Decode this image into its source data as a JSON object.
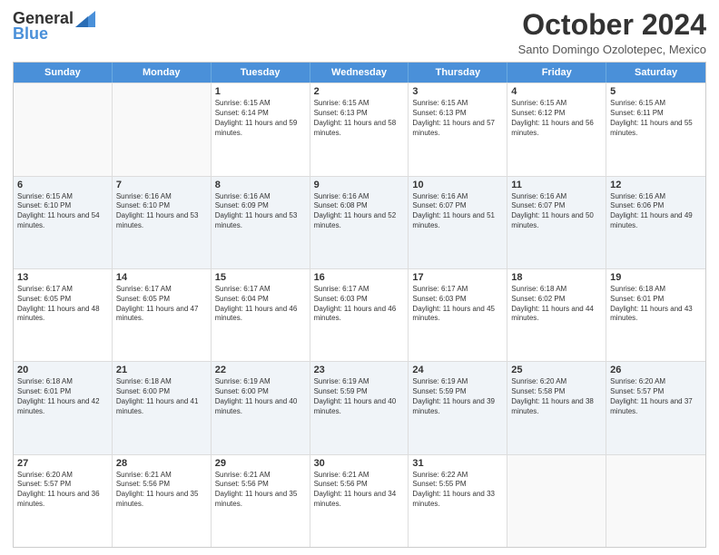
{
  "logo": {
    "general": "General",
    "blue": "Blue"
  },
  "title": "October 2024",
  "location": "Santo Domingo Ozolotepec, Mexico",
  "days": [
    "Sunday",
    "Monday",
    "Tuesday",
    "Wednesday",
    "Thursday",
    "Friday",
    "Saturday"
  ],
  "weeks": [
    [
      {
        "day": "",
        "info": "",
        "empty": true
      },
      {
        "day": "",
        "info": "",
        "empty": true
      },
      {
        "day": "1",
        "info": "Sunrise: 6:15 AM\nSunset: 6:14 PM\nDaylight: 11 hours and 59 minutes."
      },
      {
        "day": "2",
        "info": "Sunrise: 6:15 AM\nSunset: 6:13 PM\nDaylight: 11 hours and 58 minutes."
      },
      {
        "day": "3",
        "info": "Sunrise: 6:15 AM\nSunset: 6:13 PM\nDaylight: 11 hours and 57 minutes."
      },
      {
        "day": "4",
        "info": "Sunrise: 6:15 AM\nSunset: 6:12 PM\nDaylight: 11 hours and 56 minutes."
      },
      {
        "day": "5",
        "info": "Sunrise: 6:15 AM\nSunset: 6:11 PM\nDaylight: 11 hours and 55 minutes."
      }
    ],
    [
      {
        "day": "6",
        "info": "Sunrise: 6:15 AM\nSunset: 6:10 PM\nDaylight: 11 hours and 54 minutes.",
        "shaded": true
      },
      {
        "day": "7",
        "info": "Sunrise: 6:16 AM\nSunset: 6:10 PM\nDaylight: 11 hours and 53 minutes.",
        "shaded": true
      },
      {
        "day": "8",
        "info": "Sunrise: 6:16 AM\nSunset: 6:09 PM\nDaylight: 11 hours and 53 minutes.",
        "shaded": true
      },
      {
        "day": "9",
        "info": "Sunrise: 6:16 AM\nSunset: 6:08 PM\nDaylight: 11 hours and 52 minutes.",
        "shaded": true
      },
      {
        "day": "10",
        "info": "Sunrise: 6:16 AM\nSunset: 6:07 PM\nDaylight: 11 hours and 51 minutes.",
        "shaded": true
      },
      {
        "day": "11",
        "info": "Sunrise: 6:16 AM\nSunset: 6:07 PM\nDaylight: 11 hours and 50 minutes.",
        "shaded": true
      },
      {
        "day": "12",
        "info": "Sunrise: 6:16 AM\nSunset: 6:06 PM\nDaylight: 11 hours and 49 minutes.",
        "shaded": true
      }
    ],
    [
      {
        "day": "13",
        "info": "Sunrise: 6:17 AM\nSunset: 6:05 PM\nDaylight: 11 hours and 48 minutes."
      },
      {
        "day": "14",
        "info": "Sunrise: 6:17 AM\nSunset: 6:05 PM\nDaylight: 11 hours and 47 minutes."
      },
      {
        "day": "15",
        "info": "Sunrise: 6:17 AM\nSunset: 6:04 PM\nDaylight: 11 hours and 46 minutes."
      },
      {
        "day": "16",
        "info": "Sunrise: 6:17 AM\nSunset: 6:03 PM\nDaylight: 11 hours and 46 minutes."
      },
      {
        "day": "17",
        "info": "Sunrise: 6:17 AM\nSunset: 6:03 PM\nDaylight: 11 hours and 45 minutes."
      },
      {
        "day": "18",
        "info": "Sunrise: 6:18 AM\nSunset: 6:02 PM\nDaylight: 11 hours and 44 minutes."
      },
      {
        "day": "19",
        "info": "Sunrise: 6:18 AM\nSunset: 6:01 PM\nDaylight: 11 hours and 43 minutes."
      }
    ],
    [
      {
        "day": "20",
        "info": "Sunrise: 6:18 AM\nSunset: 6:01 PM\nDaylight: 11 hours and 42 minutes.",
        "shaded": true
      },
      {
        "day": "21",
        "info": "Sunrise: 6:18 AM\nSunset: 6:00 PM\nDaylight: 11 hours and 41 minutes.",
        "shaded": true
      },
      {
        "day": "22",
        "info": "Sunrise: 6:19 AM\nSunset: 6:00 PM\nDaylight: 11 hours and 40 minutes.",
        "shaded": true
      },
      {
        "day": "23",
        "info": "Sunrise: 6:19 AM\nSunset: 5:59 PM\nDaylight: 11 hours and 40 minutes.",
        "shaded": true
      },
      {
        "day": "24",
        "info": "Sunrise: 6:19 AM\nSunset: 5:59 PM\nDaylight: 11 hours and 39 minutes.",
        "shaded": true
      },
      {
        "day": "25",
        "info": "Sunrise: 6:20 AM\nSunset: 5:58 PM\nDaylight: 11 hours and 38 minutes.",
        "shaded": true
      },
      {
        "day": "26",
        "info": "Sunrise: 6:20 AM\nSunset: 5:57 PM\nDaylight: 11 hours and 37 minutes.",
        "shaded": true
      }
    ],
    [
      {
        "day": "27",
        "info": "Sunrise: 6:20 AM\nSunset: 5:57 PM\nDaylight: 11 hours and 36 minutes."
      },
      {
        "day": "28",
        "info": "Sunrise: 6:21 AM\nSunset: 5:56 PM\nDaylight: 11 hours and 35 minutes."
      },
      {
        "day": "29",
        "info": "Sunrise: 6:21 AM\nSunset: 5:56 PM\nDaylight: 11 hours and 35 minutes."
      },
      {
        "day": "30",
        "info": "Sunrise: 6:21 AM\nSunset: 5:56 PM\nDaylight: 11 hours and 34 minutes."
      },
      {
        "day": "31",
        "info": "Sunrise: 6:22 AM\nSunset: 5:55 PM\nDaylight: 11 hours and 33 minutes."
      },
      {
        "day": "",
        "info": "",
        "empty": true
      },
      {
        "day": "",
        "info": "",
        "empty": true
      }
    ]
  ]
}
